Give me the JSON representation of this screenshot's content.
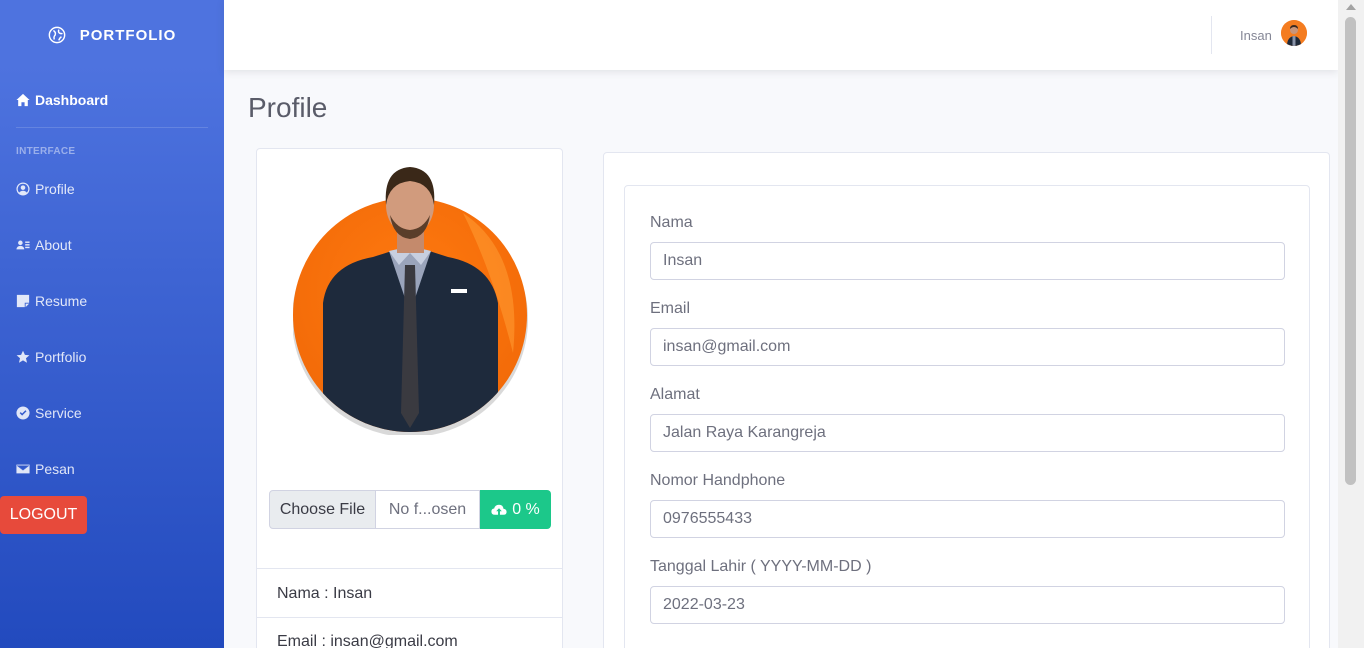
{
  "brand": {
    "name": "PORTFOLIO",
    "icon": "globe-icon"
  },
  "sidebar": {
    "dashboard": {
      "label": "Dashboard",
      "icon": "home-icon"
    },
    "heading": "INTERFACE",
    "items": [
      {
        "label": "Profile",
        "icon": "user-circle-icon"
      },
      {
        "label": "About",
        "icon": "address-card-icon"
      },
      {
        "label": "Resume",
        "icon": "sticky-note-icon"
      },
      {
        "label": "Portfolio",
        "icon": "star-icon"
      },
      {
        "label": "Service",
        "icon": "check-badge-icon"
      },
      {
        "label": "Pesan",
        "icon": "envelope-icon"
      }
    ],
    "logout": "LOGOUT"
  },
  "topbar": {
    "username": "Insan"
  },
  "page": {
    "title": "Profile"
  },
  "profile_card": {
    "choose_file": "Choose File",
    "file_name": "No f...osen",
    "upload_label": "0 %",
    "info": [
      "Nama : Insan",
      "Email : insan@gmail.com"
    ]
  },
  "form": {
    "fields": [
      {
        "label": "Nama",
        "value": "Insan"
      },
      {
        "label": "Email",
        "value": "insan@gmail.com"
      },
      {
        "label": "Alamat",
        "value": "Jalan Raya Karangreja"
      },
      {
        "label": "Nomor Handphone",
        "value": "0976555433"
      },
      {
        "label": "Tanggal Lahir ( YYYY-MM-DD )",
        "value": "2022-03-23"
      }
    ]
  },
  "colors": {
    "sidebar_top": "#4e73df",
    "sidebar_bottom": "#224abe",
    "logout": "#e74a3b",
    "upload": "#1cc88a",
    "avatar_bg": "#f47c20"
  }
}
